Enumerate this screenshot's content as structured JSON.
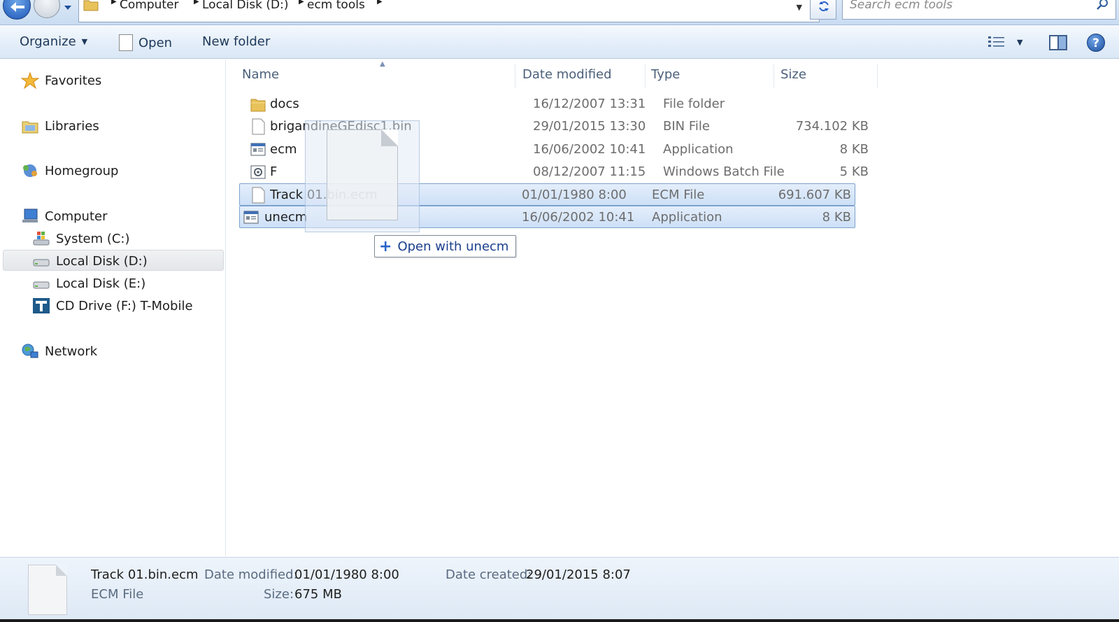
{
  "address": {
    "crumbs": [
      "Computer",
      "Local Disk (D:)",
      "ecm tools"
    ],
    "search_placeholder": "Search ecm tools"
  },
  "toolbar": {
    "organize_label": "Organize",
    "open_label": "Open",
    "new_folder_label": "New folder"
  },
  "nav": {
    "favorites": "Favorites",
    "libraries": "Libraries",
    "homegroup": "Homegroup",
    "computer": "Computer",
    "drives": [
      {
        "label": "System (C:)"
      },
      {
        "label": "Local Disk (D:)",
        "selected": true
      },
      {
        "label": "Local Disk (E:)"
      },
      {
        "label": "CD Drive (F:) T-Mobile"
      }
    ],
    "network": "Network"
  },
  "columns": {
    "name": "Name",
    "date": "Date modified",
    "type": "Type",
    "size": "Size"
  },
  "files": [
    {
      "name": "docs",
      "date": "16/12/2007 13:31",
      "type": "File folder",
      "size": "",
      "icon": "folder-icon",
      "selected": false
    },
    {
      "name": "brigandineGEdisc1.bin",
      "date": "29/01/2015 13:30",
      "type": "BIN File",
      "size": "734.102 KB",
      "icon": "file-icon",
      "selected": false
    },
    {
      "name": "ecm",
      "date": "16/06/2002 10:41",
      "type": "Application",
      "size": "8 KB",
      "icon": "application-icon",
      "selected": false
    },
    {
      "name": "F",
      "date": "08/12/2007 11:15",
      "type": "Windows Batch File",
      "size": "5 KB",
      "icon": "batch-file-icon",
      "selected": false
    },
    {
      "name": "Track 01.bin.ecm",
      "date": "01/01/1980 8:00",
      "type": "ECM File",
      "size": "691.607 KB",
      "icon": "file-icon",
      "selected": true
    },
    {
      "name": "unecm",
      "date": "16/06/2002 10:41",
      "type": "Application",
      "size": "8 KB",
      "icon": "application-icon",
      "selected": true
    }
  ],
  "drag_tooltip": {
    "label": "Open with unecm"
  },
  "details": {
    "name": "Track 01.bin.ecm",
    "type": "ECM File",
    "date_modified_label": "Date modified:",
    "date_modified": "01/01/1980 8:00",
    "size_label": "Size:",
    "size": "675 MB",
    "date_created_label": "Date created:",
    "date_created": "29/01/2015 8:07"
  }
}
